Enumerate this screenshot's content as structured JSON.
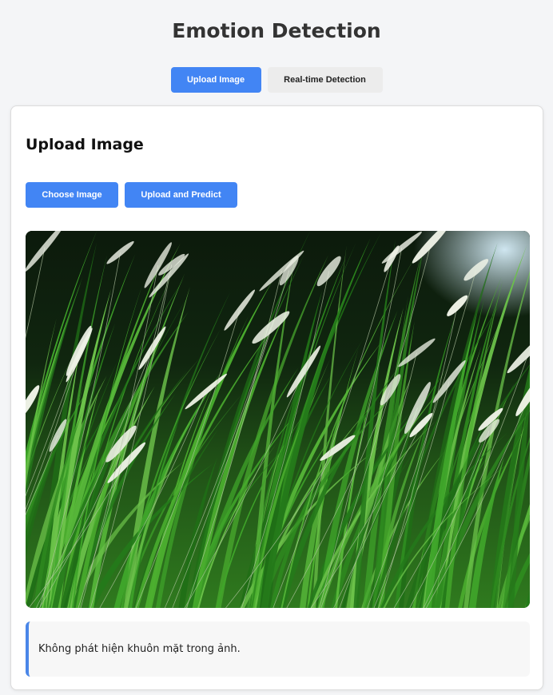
{
  "header": {
    "title": "Emotion Detection"
  },
  "tabs": [
    {
      "label": "Upload Image",
      "active": true
    },
    {
      "label": "Real-time Detection",
      "active": false
    }
  ],
  "upload_card": {
    "title": "Upload Image",
    "choose_button_label": "Choose Image",
    "upload_button_label": "Upload and Predict"
  },
  "preview": {
    "subject": "tall green grass with white feathery plumes"
  },
  "result": {
    "message": "Không phát hiện khuôn mặt trong ảnh."
  },
  "colors": {
    "accent": "#4285f4",
    "background": "#f4f5f7",
    "inactive_tab": "#ececec",
    "result_border": "#4a86e8"
  }
}
